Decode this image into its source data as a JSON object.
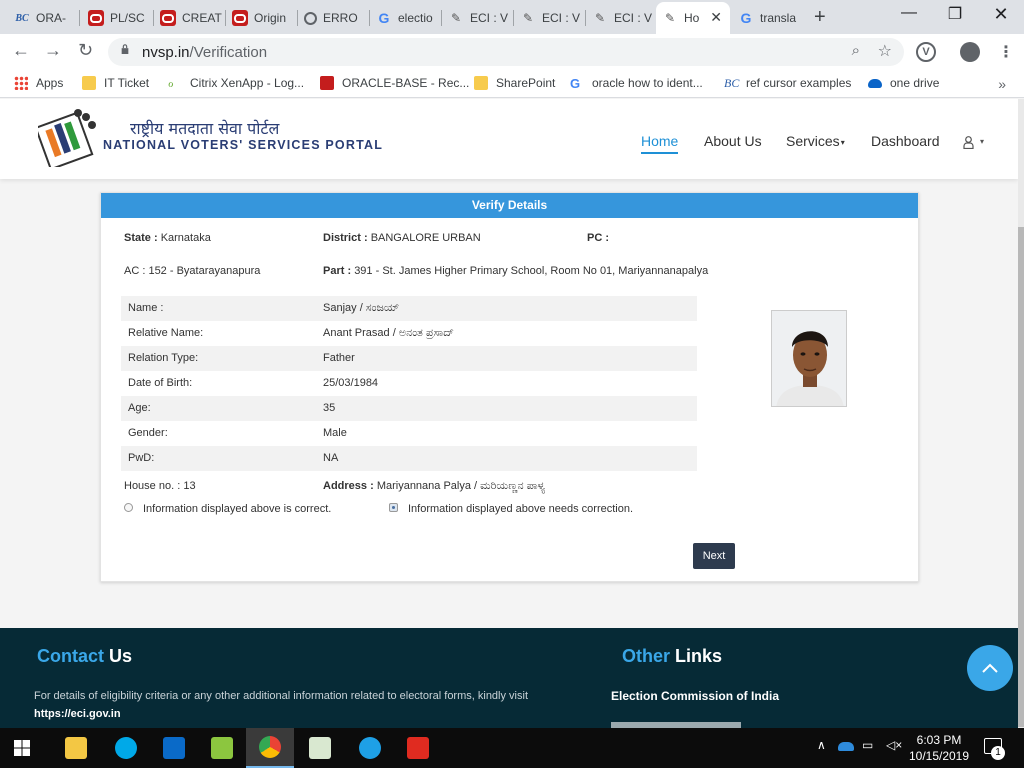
{
  "browser": {
    "tabs": [
      {
        "title": "ORA-",
        "icon": "bc-icon"
      },
      {
        "title": "PL/SC",
        "icon": "oracle-icon"
      },
      {
        "title": "CREAT",
        "icon": "oracle-icon"
      },
      {
        "title": "Origin",
        "icon": "oracle-icon"
      },
      {
        "title": "ERRO",
        "icon": "globe-icon"
      },
      {
        "title": "electio",
        "icon": "google-icon"
      },
      {
        "title": "ECI : V",
        "icon": "eci-icon"
      },
      {
        "title": "ECI : V",
        "icon": "eci-icon"
      },
      {
        "title": "ECI : V",
        "icon": "eci-icon"
      },
      {
        "title": "Ho",
        "icon": "eci-icon"
      },
      {
        "title": "transla",
        "icon": "google-icon"
      }
    ],
    "url_host": "nvsp.in",
    "url_path": "/Verification",
    "ext_label": "V",
    "bookmarks": [
      {
        "label": "Apps"
      },
      {
        "label": "IT Ticket"
      },
      {
        "label": "Citrix XenApp - Log..."
      },
      {
        "label": "ORACLE-BASE - Rec..."
      },
      {
        "label": "SharePoint"
      },
      {
        "label": "oracle how to ident..."
      },
      {
        "label": "ref cursor examples"
      },
      {
        "label": "one drive"
      }
    ],
    "bookmarks_more": "»"
  },
  "site": {
    "logo_hindi": "राष्ट्रीय मतदाता सेवा पोर्टल",
    "logo_english": "NATIONAL VOTERS' SERVICES PORTAL",
    "nav": {
      "home": "Home",
      "about": "About Us",
      "services": "Services",
      "dashboard": "Dashboard"
    },
    "accent_color": "#1e90d6"
  },
  "verify": {
    "heading": "Verify Details",
    "state_label": "State :",
    "state_value": "Karnataka",
    "district_label": "District :",
    "district_value": "BANGALORE URBAN",
    "pc_label": "PC :",
    "pc_value": "",
    "ac_value": "AC : 152 - Byatarayanapura",
    "part_label": "Part :",
    "part_value": "391 - St. James Higher Primary School, Room No 01, Mariyannanapalya",
    "rows": [
      {
        "label": "Name :",
        "value": "Sanjay / ಸಂಜಯ್"
      },
      {
        "label": "Relative Name:",
        "value": "Anant Prasad / ಅನಂತ ಪ್ರಸಾದ್"
      },
      {
        "label": "Relation Type:",
        "value": "Father"
      },
      {
        "label": "Date of Birth:",
        "value": "25/03/1984"
      },
      {
        "label": "Age:",
        "value": "35"
      },
      {
        "label": "Gender:",
        "value": "Male"
      },
      {
        "label": "PwD:",
        "value": "NA"
      }
    ],
    "house_label": "House no. :",
    "house_value": "13",
    "address_label": "Address :",
    "address_value": "Mariyannana Palya / ಮರಿಯಣ್ಣನ ಪಾಳ್ಯ",
    "option_correct": "Information displayed above is correct.",
    "option_correction": "Information displayed above needs correction.",
    "selected_option": "needs-correction",
    "next_label": "Next"
  },
  "footer": {
    "contact_accent": "Contact",
    "contact_rest": " Us",
    "other_accent": "Other",
    "other_rest": " Links",
    "contact_text": "For details of eligibility criteria or any other additional information related to electoral forms, kindly visit",
    "contact_link": "https://eci.gov.in",
    "other_link_1": "Election Commission of India",
    "accent_color": "#3aa7e8"
  },
  "taskbar": {
    "time": "6:03 PM",
    "date": "10/15/2019",
    "notification_count": "1"
  }
}
